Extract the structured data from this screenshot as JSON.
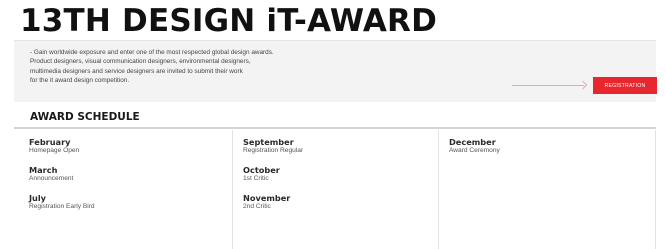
{
  "page_title": "13TH DESIGN iT-AWARD",
  "intro": {
    "lines": [
      "- Gain worldwide exposure and enter one of the most respected global design awards.",
      "Product designers, visual communication designers, environmental designers,",
      "multimedia designers and service designers are invited to submit their work",
      "for the it award design competition."
    ]
  },
  "registration_label": "REGISTRATION",
  "colors": {
    "accent": "#e8262d",
    "arrow": "#e8a9a4"
  },
  "schedule": {
    "heading": "AWARD SCHEDULE",
    "columns": [
      [
        {
          "month": "February",
          "event": "Homepage Open"
        },
        {
          "month": "March",
          "event": "Announcement"
        },
        {
          "month": "July",
          "event": "Registration Early Bird"
        }
      ],
      [
        {
          "month": "September",
          "event": "Registration Regular"
        },
        {
          "month": "October",
          "event": "1st Critic"
        },
        {
          "month": "November",
          "event": "2nd Critic"
        }
      ],
      [
        {
          "month": "December",
          "event": "Award Ceremony"
        }
      ]
    ]
  }
}
